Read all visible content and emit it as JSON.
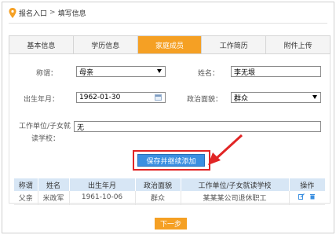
{
  "breadcrumb": {
    "home": "报名入口",
    "separator": ">",
    "current": "填写信息"
  },
  "tabs": [
    {
      "label": "基本信息",
      "active": false
    },
    {
      "label": "学历信息",
      "active": false
    },
    {
      "label": "家庭成员",
      "active": true
    },
    {
      "label": "工作简历",
      "active": false
    },
    {
      "label": "附件上传",
      "active": false
    }
  ],
  "form": {
    "relation": {
      "label": "称谓：",
      "value": "母亲"
    },
    "name": {
      "label": "姓名：",
      "value": "李无垠"
    },
    "birth": {
      "label": "出生年月：",
      "value": "1962-01-30"
    },
    "political": {
      "label": "政治面貌：",
      "value": "群众"
    },
    "workplace": {
      "label_line1": "工作单位/子女就",
      "label_line2": "读学校：",
      "value": "无"
    }
  },
  "save_button": "保存并继续添加",
  "table": {
    "headers": [
      "称谓",
      "姓名",
      "出生年月",
      "政治面貌",
      "工作单位/子女就读学校",
      "操作"
    ],
    "rows": [
      {
        "relation": "父亲",
        "name": "米政军",
        "birth": "1961-10-06",
        "political": "群众",
        "workplace": "某某某公司退休职工"
      }
    ]
  },
  "next_button": "下一步",
  "colors": {
    "accent": "#f5a024",
    "primary": "#3b8fe0",
    "highlight": "#e12525",
    "table_header": "#d7e6f5"
  }
}
